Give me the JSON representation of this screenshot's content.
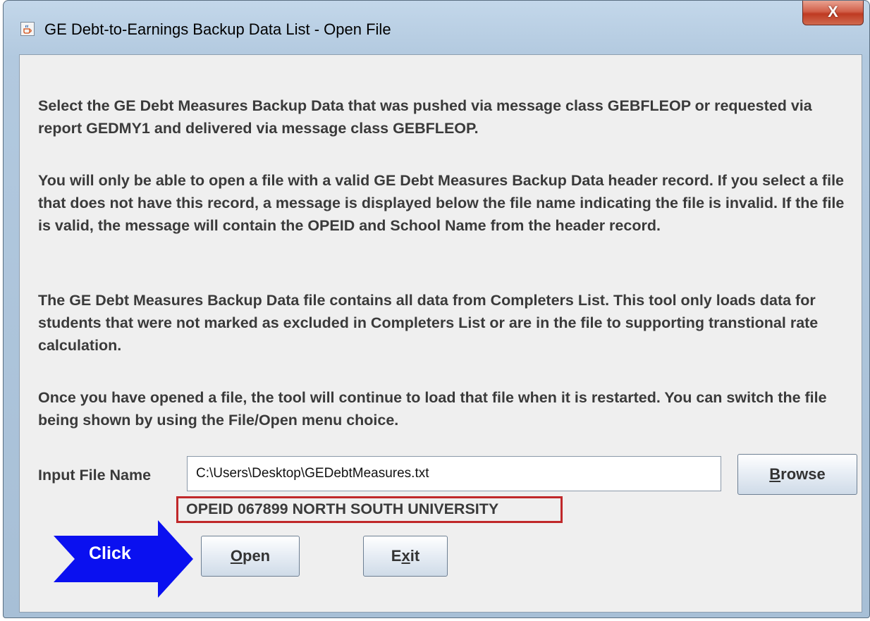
{
  "window": {
    "title": "GE Debt-to-Earnings Backup Data List  - Open File",
    "close_label": "X"
  },
  "instructions": {
    "p1": "Select the GE Debt Measures Backup Data that was pushed via message class GEBFLEOP or requested via report GEDMY1 and delivered via message class GEBFLEOP.",
    "p2": "You will only be able to open a file with a valid GE Debt Measures Backup Data header record. If you select a file that does not have this record, a message is displayed below the file name indicating the file is invalid. If the file is valid, the message will contain the OPEID and School Name from the header record.",
    "p3": "The GE Debt Measures Backup Data file contains all data from Completers List. This tool only loads data for students that were not marked as excluded in Completers List or are in the file to supporting transtional rate calculation.",
    "p4": "Once you have opened a file, the tool will continue to load that file when it is restarted. You can switch the file being shown by using the File/Open menu choice."
  },
  "file_input": {
    "label": "Input File Name",
    "value": "C:\\Users\\Desktop\\GEDebtMeasures.txt"
  },
  "browse_button": {
    "mnemonic": "B",
    "rest": "rowse"
  },
  "status_message": "OPEID 067899 NORTH SOUTH UNIVERSITY",
  "open_button": {
    "mnemonic": "O",
    "rest": "pen"
  },
  "exit_button": {
    "pre": "E",
    "mnemonic": "x",
    "post": "it"
  },
  "annotation": {
    "click_label": "Click"
  },
  "colors": {
    "annotation_arrow": "#0a10f0",
    "highlight_border": "#c0282a",
    "close_button": "#c84a33"
  },
  "icons": {
    "app_icon": "java-cup-icon",
    "close_icon": "close-x-icon",
    "arrow": "right-arrow-annotation"
  }
}
